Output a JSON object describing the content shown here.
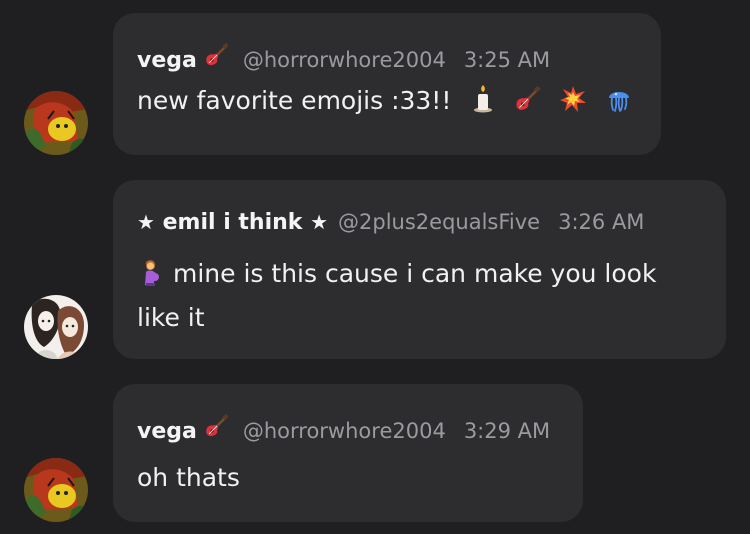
{
  "messages": [
    {
      "author": "vega",
      "author_emoji": "guitar-icon",
      "handle": "@horrorwhore2004",
      "time": "3:25 AM",
      "text": "new favorite emojis :33!!",
      "trailing_emojis": [
        "candle-icon",
        "guitar-icon",
        "collision-icon",
        "jellyfish-icon"
      ]
    },
    {
      "author_prefix": "★",
      "author": "emil i think",
      "author_suffix": "★",
      "handle": "@2plus2equalsFive",
      "time": "3:26 AM",
      "leading_emoji": "pregnant-person-icon",
      "text": "mine is this cause i can make you look like it"
    },
    {
      "author": "vega",
      "author_emoji": "guitar-icon",
      "handle": "@horrorwhore2004",
      "time": "3:29 AM",
      "text": "oh thats"
    }
  ],
  "colors": {
    "background": "#1f1f21",
    "bubble": "#2d2d30",
    "name": "#f4f4f6",
    "meta": "#9a9aa0",
    "text": "#f1f1f3"
  }
}
